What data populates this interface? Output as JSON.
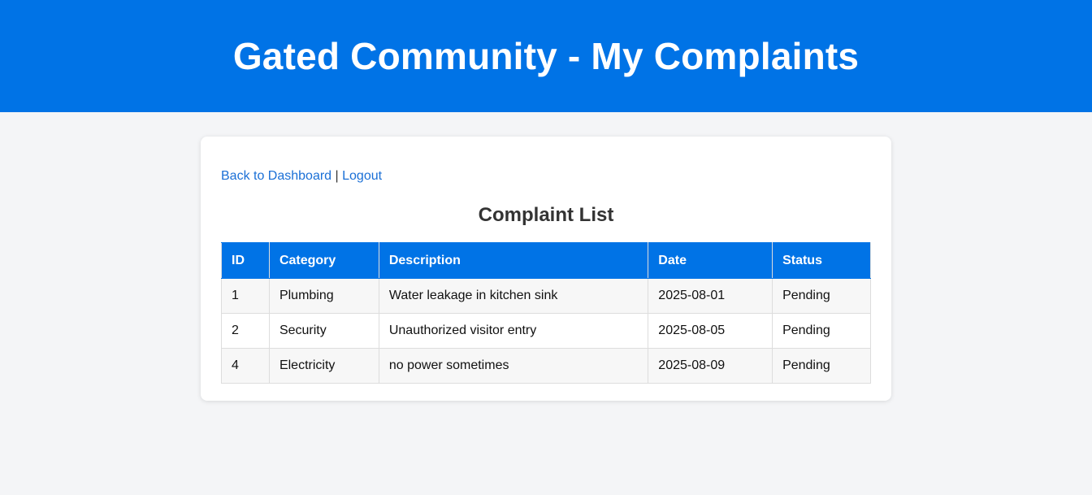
{
  "header": {
    "title": "Gated Community - My Complaints"
  },
  "nav": {
    "back_label": "Back to Dashboard",
    "separator": " | ",
    "logout_label": "Logout"
  },
  "main": {
    "heading": "Complaint List",
    "columns": [
      "ID",
      "Category",
      "Description",
      "Date",
      "Status"
    ],
    "rows": [
      [
        "1",
        "Plumbing",
        "Water leakage in kitchen sink",
        "2025-08-01",
        "Pending"
      ],
      [
        "2",
        "Security",
        "Unauthorized visitor entry",
        "2025-08-05",
        "Pending"
      ],
      [
        "4",
        "Electricity",
        "no power sometimes",
        "2025-08-09",
        "Pending"
      ]
    ]
  },
  "colors": {
    "primary": "#0073e6",
    "link": "#1a6fd6",
    "background": "#f4f5f7"
  }
}
